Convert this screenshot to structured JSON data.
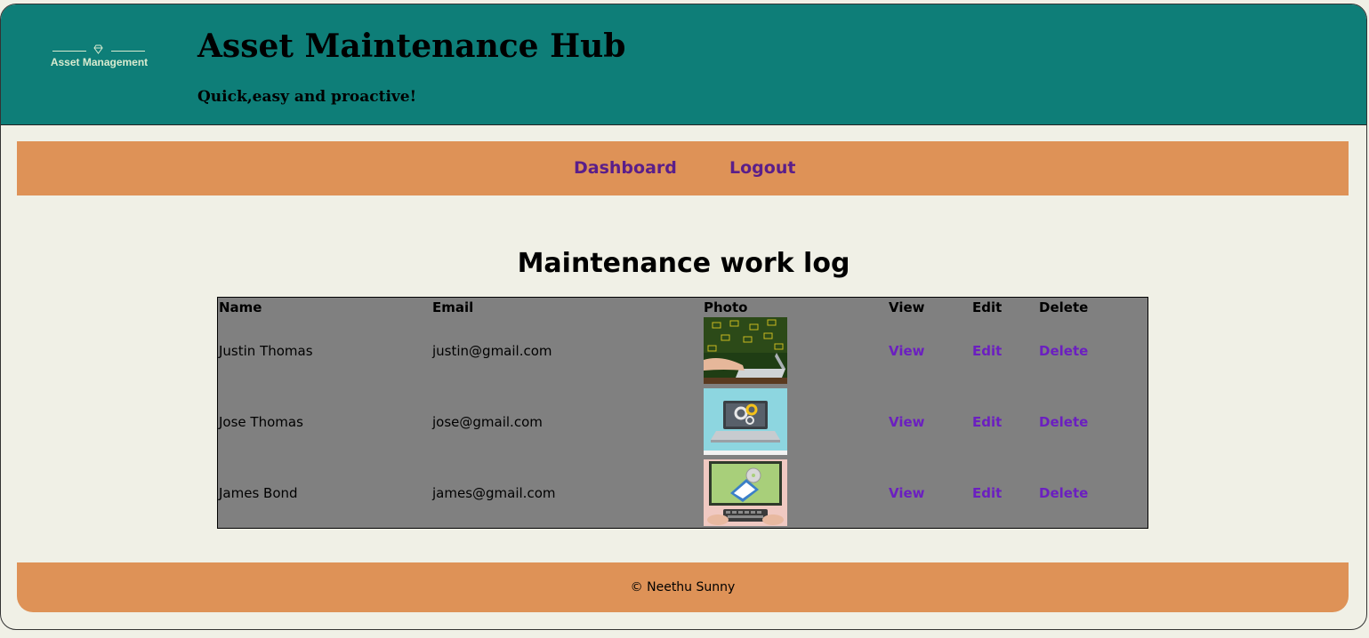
{
  "header": {
    "logo_text": "Asset Management",
    "title": "Asset Maintenance Hub",
    "tagline": "Quick,easy and proactive!"
  },
  "nav": {
    "dashboard": "Dashboard",
    "logout": "Logout"
  },
  "main": {
    "heading": "Maintenance work log",
    "columns": [
      "Name",
      "Email",
      "Photo",
      "View",
      "Edit",
      "Delete"
    ],
    "rows": [
      {
        "name": "Justin Thomas",
        "email": "justin@gmail.com",
        "photo_icon": "laptop-mail-photo",
        "view": "View",
        "edit": "Edit",
        "delete": "Delete"
      },
      {
        "name": "Jose Thomas",
        "email": "jose@gmail.com",
        "photo_icon": "laptop-gears-photo",
        "view": "View",
        "edit": "Edit",
        "delete": "Delete"
      },
      {
        "name": "James Bond",
        "email": "james@gmail.com",
        "photo_icon": "monitor-disc-photo",
        "view": "View",
        "edit": "Edit",
        "delete": "Delete"
      }
    ]
  },
  "footer": {
    "text": "© Neethu Sunny"
  },
  "colors": {
    "header_bg": "#0e7e78",
    "nav_bg": "#de9257",
    "page_bg": "#f0f0e6",
    "table_bg": "#808080",
    "link_color": "#6b1fc0",
    "nav_link_color": "#5a1e8a"
  }
}
